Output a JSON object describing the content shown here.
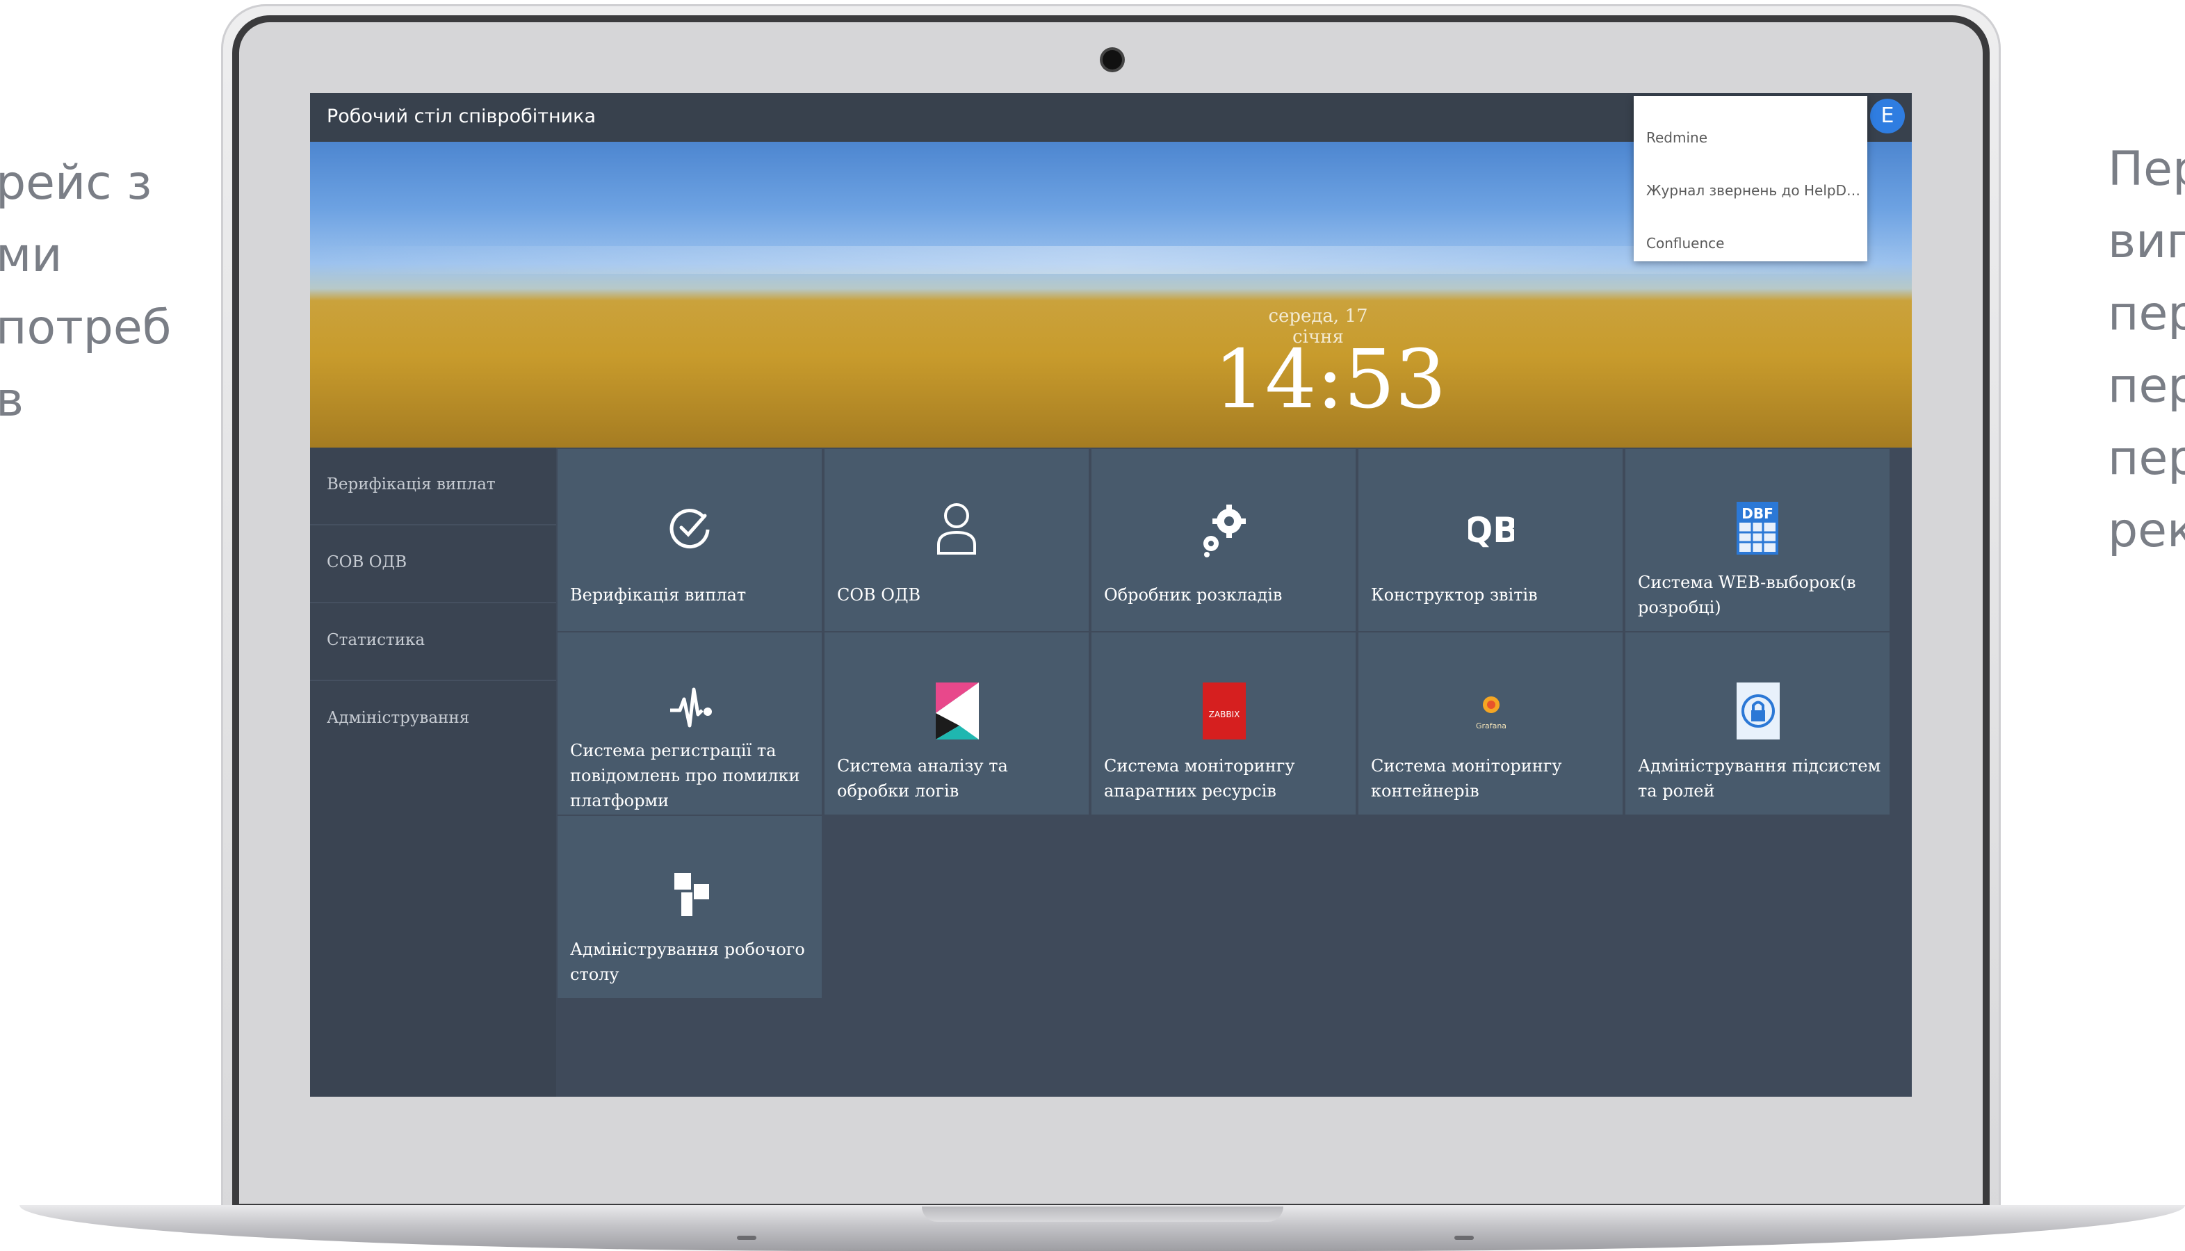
{
  "slide": {
    "left_lines": [
      "рейс з",
      "ми",
      " потреб",
      "в"
    ],
    "right_lines": [
      "Пер",
      "виг",
      "пер",
      "пер",
      "пер",
      "рек"
    ]
  },
  "app": {
    "title": "Робочий стіл співробітника",
    "user_initial": "E"
  },
  "menu": {
    "items": [
      "Redmine",
      "Журнал звернень до HelpDesk",
      "Confluence"
    ]
  },
  "clock": {
    "date": "середа, 17 січня",
    "time": "14:53"
  },
  "sidebar": {
    "items": [
      "Верифікація виплат",
      "СОВ ОДВ",
      "Статистика",
      "Адміністрування"
    ]
  },
  "tiles": [
    {
      "label": "Верифікація виплат",
      "icon": "check-circle-icon"
    },
    {
      "label": "СОВ ОДВ",
      "icon": "user-icon"
    },
    {
      "label": "Обробник розкладів",
      "icon": "gears-icon"
    },
    {
      "label": "Конструктор звітів",
      "icon": "qb-icon"
    },
    {
      "label": "Система WEB-выборок(в розробці)",
      "icon": "dbf-icon",
      "icon_text": "DBF"
    },
    {
      "label": "Система регистрації та повідомлень про помилки платформи",
      "icon": "pulse-icon"
    },
    {
      "label": "Система аналізу та обробки логів",
      "icon": "kibana-icon"
    },
    {
      "label": "Система моніторингу апаратних ресурсів",
      "icon": "zabbix-icon",
      "icon_text": "ZABBIX"
    },
    {
      "label": "Система моніторингу контейнерів",
      "icon": "grafana-icon",
      "icon_text": "Grafana"
    },
    {
      "label": "Адміністрування підсистем та ролей",
      "icon": "lock-icon"
    },
    {
      "label": "Адміністрування робочого столу",
      "icon": "windows-icon"
    }
  ],
  "colors": {
    "topbar": "#38414d",
    "screen_bg": "#3f4a5a",
    "tile_bg": "#485a6c",
    "avatar": "#2f7de1"
  }
}
